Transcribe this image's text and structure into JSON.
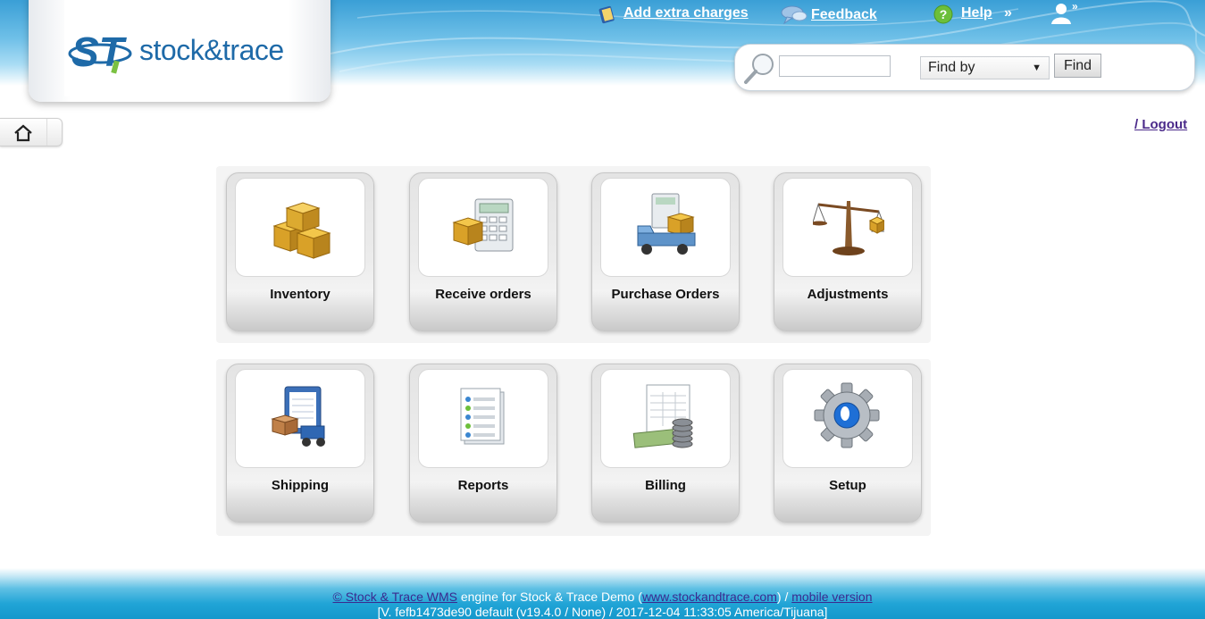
{
  "brand": {
    "logo_text": "stock&trace",
    "logo_mark": "ST"
  },
  "header": {
    "add_extra_charges": "Add extra charges",
    "feedback": "Feedback",
    "help": "Help",
    "chevron": "»",
    "user_chevron": "»",
    "icons": [
      "book-icon",
      "speech-bubble-icon",
      "help-icon",
      "user-icon"
    ]
  },
  "search": {
    "value": "",
    "placeholder": "",
    "findby_selected": "Find by",
    "find_label": "Find"
  },
  "nav": {
    "logout": "/ Logout"
  },
  "tiles": [
    {
      "label": "Inventory",
      "icon": "boxes-icon"
    },
    {
      "label": "Receive orders",
      "icon": "box-calculator-icon"
    },
    {
      "label": "Purchase Orders",
      "icon": "truck-calculator-icon"
    },
    {
      "label": "Adjustments",
      "icon": "balance-scale-icon"
    },
    {
      "label": "Shipping",
      "icon": "clipboard-handtruck-icon"
    },
    {
      "label": "Reports",
      "icon": "checklist-report-icon"
    },
    {
      "label": "Billing",
      "icon": "invoice-coins-icon"
    },
    {
      "label": "Setup",
      "icon": "gear-icon"
    }
  ],
  "footer": {
    "copyright_link": "© Stock & Trace WMS",
    "engine_text": " engine for Stock & Trace Demo (",
    "site_link": "www.stockandtrace.com",
    "mid_text": ") / ",
    "mobile_link": "mobile version",
    "version": "[V. fefb1473de90 default (v19.4.0 / None) / 2017-12-04 11:33:05 America/Tijuana]"
  },
  "colors": {
    "header_blue": "#3a9fd6",
    "footer_blue": "#1598cc",
    "link_purple": "#4b2a8a"
  }
}
